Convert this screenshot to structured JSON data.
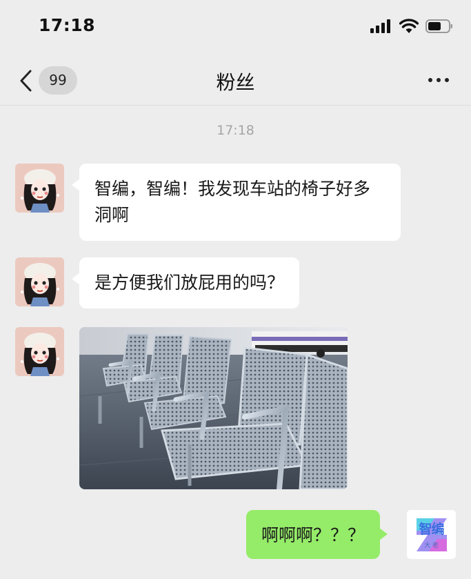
{
  "status_bar": {
    "time": "17:18"
  },
  "nav": {
    "back_badge": "99",
    "title": "粉丝"
  },
  "chat": {
    "timestamp": "17:18",
    "messages": [
      {
        "side": "in",
        "type": "text",
        "text": "智编，智编！我发现车站的椅子好多洞啊"
      },
      {
        "side": "in",
        "type": "text",
        "text": "是方便我们放屁用的吗？"
      },
      {
        "side": "in",
        "type": "image",
        "description": "metal-perforated-station-chairs"
      },
      {
        "side": "out",
        "type": "text",
        "text": "啊啊啊？？？"
      }
    ]
  },
  "self_avatar": {
    "logo_text": "智编",
    "sub_text": "大 老"
  },
  "colors": {
    "background": "#ededed",
    "incoming_bubble": "#ffffff",
    "outgoing_bubble": "#95ec69"
  }
}
